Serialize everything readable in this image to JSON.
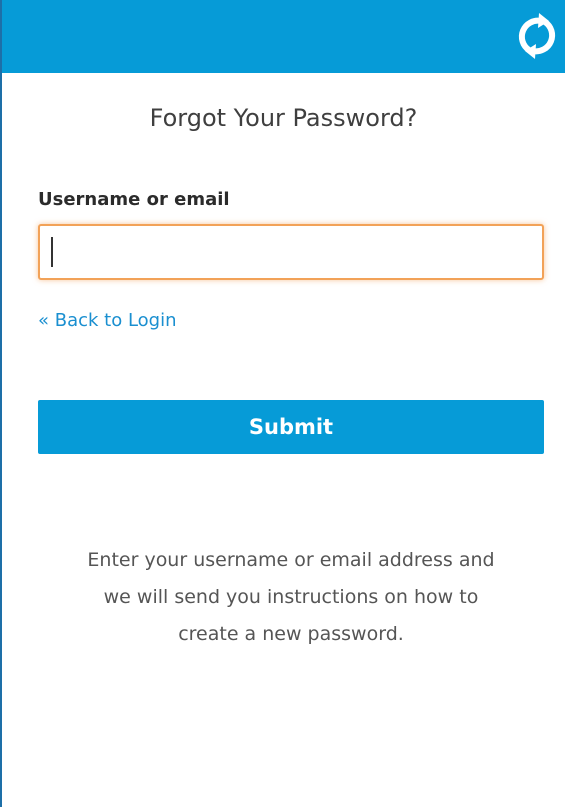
{
  "header": {
    "background_color": "#069bd7",
    "logo_icon": "sync-arrows-icon"
  },
  "form": {
    "title": "Forgot Your Password?",
    "username_label": "Username or email",
    "username_value": "",
    "back_link": "« Back to Login",
    "submit_label": "Submit",
    "help_lines": [
      "Enter your username or email address and",
      "we will send you instructions on how to",
      "create a new password."
    ]
  },
  "colors": {
    "accent": "#069bd7",
    "link": "#1a8fd0",
    "focus_border": "#f2a258"
  }
}
